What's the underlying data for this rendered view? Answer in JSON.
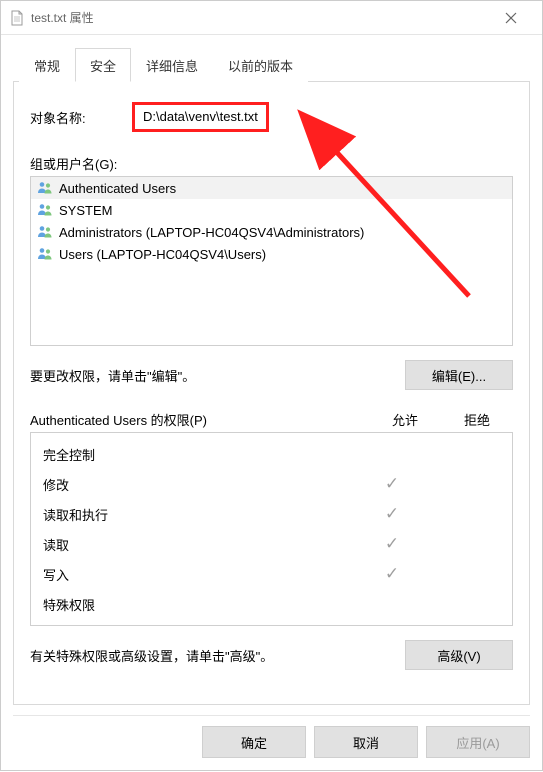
{
  "window": {
    "title": "test.txt 属性"
  },
  "tabs": {
    "general": "常规",
    "security": "安全",
    "details": "详细信息",
    "previous": "以前的版本"
  },
  "object": {
    "label": "对象名称:",
    "value": "D:\\data\\venv\\test.txt"
  },
  "groups": {
    "label": "组或用户名(G):",
    "items": [
      {
        "name": "Authenticated Users",
        "selected": true
      },
      {
        "name": "SYSTEM",
        "selected": false
      },
      {
        "name": "Administrators (LAPTOP-HC04QSV4\\Administrators)",
        "selected": false
      },
      {
        "name": "Users (LAPTOP-HC04QSV4\\Users)",
        "selected": false
      }
    ]
  },
  "editHint": "要更改权限，请单击\"编辑\"。",
  "editBtn": "编辑(E)...",
  "permHeader": {
    "lead": "Authenticated Users 的权限(P)",
    "allow": "允许",
    "deny": "拒绝"
  },
  "permissions": [
    {
      "name": "完全控制",
      "allow": false,
      "deny": false
    },
    {
      "name": "修改",
      "allow": true,
      "deny": false
    },
    {
      "name": "读取和执行",
      "allow": true,
      "deny": false
    },
    {
      "name": "读取",
      "allow": true,
      "deny": false
    },
    {
      "name": "写入",
      "allow": true,
      "deny": false
    },
    {
      "name": "特殊权限",
      "allow": false,
      "deny": false
    }
  ],
  "advHint": "有关特殊权限或高级设置，请单击\"高级\"。",
  "advBtn": "高级(V)",
  "buttons": {
    "ok": "确定",
    "cancel": "取消",
    "apply": "应用(A)"
  }
}
